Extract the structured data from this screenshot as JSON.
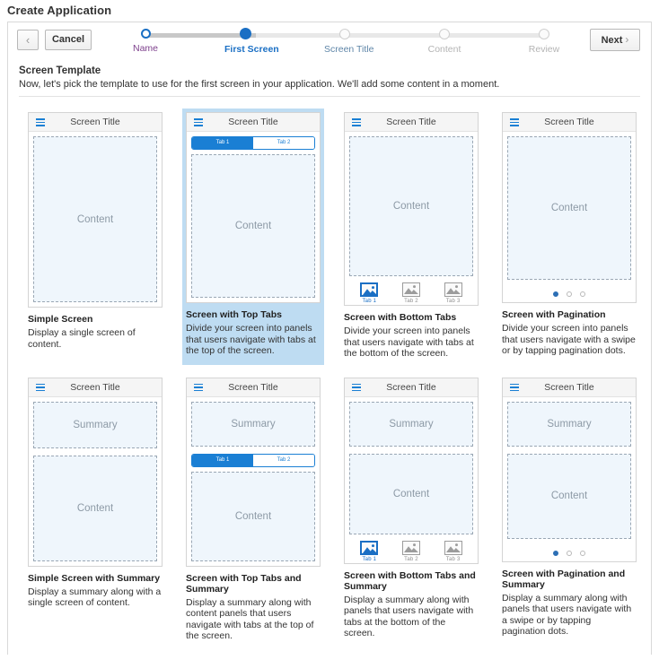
{
  "page": {
    "title": "Create Application"
  },
  "toolbar": {
    "back_label": "‹",
    "cancel_label": "Cancel",
    "next_label": "Next",
    "next_chevron": "›"
  },
  "wizard": {
    "steps": [
      {
        "label": "Name",
        "state": "done"
      },
      {
        "label": "First Screen",
        "state": "current"
      },
      {
        "label": "Screen Title",
        "state": "next"
      },
      {
        "label": "Content",
        "state": "todo"
      },
      {
        "label": "Review",
        "state": "todo"
      }
    ]
  },
  "section": {
    "title": "Screen Template",
    "subtitle": "Now, let's pick the template to use for the first screen in your application. We'll add some content in a moment."
  },
  "labels": {
    "screen_title": "Screen Title",
    "content": "Content",
    "summary": "Summary",
    "tab1": "Tab 1",
    "tab2": "Tab 2",
    "tab3": "Tab 3"
  },
  "colors": {
    "accent": "#1a7fd4",
    "selected_bg": "#bedcf2",
    "panel_fill": "#eff6fc",
    "step_done": "#7d3f8c",
    "step_todo": "#b4b4b4"
  },
  "templates": [
    {
      "name": "Simple Screen",
      "desc": "Display a single screen of content.",
      "selected": false,
      "layout": "simple"
    },
    {
      "name": "Screen with Top Tabs",
      "desc": "Divide your screen into panels that users navigate with tabs at the top of the screen.",
      "selected": true,
      "layout": "top-tabs"
    },
    {
      "name": "Screen with Bottom Tabs",
      "desc": "Divide your screen into panels that users navigate with tabs at the bottom of the screen.",
      "selected": false,
      "layout": "bottom-tabs"
    },
    {
      "name": "Screen with Pagination",
      "desc": "Divide your screen into panels that users navigate with a swipe or by tapping pagination dots.",
      "selected": false,
      "layout": "pagination"
    },
    {
      "name": "Simple Screen with Summary",
      "desc": "Display a summary along with a single screen of content.",
      "selected": false,
      "layout": "simple-summary"
    },
    {
      "name": "Screen with Top Tabs and Summary",
      "desc": "Display a summary along with content panels that users navigate with tabs at the top of the screen.",
      "selected": false,
      "layout": "top-tabs-summary"
    },
    {
      "name": "Screen with Bottom Tabs and Summary",
      "desc": "Display a summary along with panels that users navigate with tabs at the bottom of the screen.",
      "selected": false,
      "layout": "bottom-tabs-summary"
    },
    {
      "name": "Screen with Pagination and Summary",
      "desc": "Display a summary along with panels that users navigate with a swipe or by tapping pagination dots.",
      "selected": false,
      "layout": "pagination-summary"
    }
  ]
}
